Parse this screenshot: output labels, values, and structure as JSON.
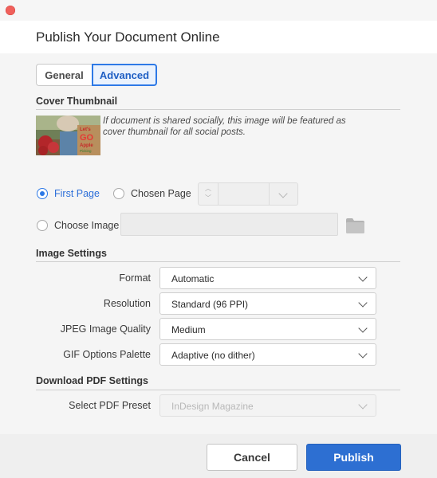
{
  "dialog": {
    "title": "Publish Your Document Online"
  },
  "tabs": [
    {
      "label": "General",
      "selected": false
    },
    {
      "label": "Advanced",
      "selected": true
    }
  ],
  "cover_thumbnail": {
    "heading": "Cover Thumbnail",
    "note": "If document is shared socially, this image will be featured as cover thumbnail for all social posts.",
    "thumb_text": [
      "Let's",
      "GO",
      "Apple",
      "Picking"
    ],
    "options": {
      "first_page": {
        "label": "First Page",
        "checked": true
      },
      "chosen_page": {
        "label": "Chosen Page",
        "checked": false,
        "value": ""
      },
      "choose_image": {
        "label": "Choose Image",
        "checked": false,
        "path": ""
      }
    }
  },
  "image_settings": {
    "heading": "Image Settings",
    "rows": [
      {
        "label": "Format",
        "value": "Automatic"
      },
      {
        "label": "Resolution",
        "value": "Standard (96 PPI)"
      },
      {
        "label": "JPEG Image Quality",
        "value": "Medium"
      },
      {
        "label": "GIF Options Palette",
        "value": "Adaptive (no dither)"
      }
    ]
  },
  "download_pdf": {
    "heading": "Download PDF Settings",
    "preset_label": "Select PDF Preset",
    "preset_value": "InDesign Magazine",
    "preset_disabled": true
  },
  "footer": {
    "cancel_label": "Cancel",
    "publish_label": "Publish"
  },
  "colors": {
    "accent": "#2d6fd2",
    "close_button": "#f0605b"
  }
}
